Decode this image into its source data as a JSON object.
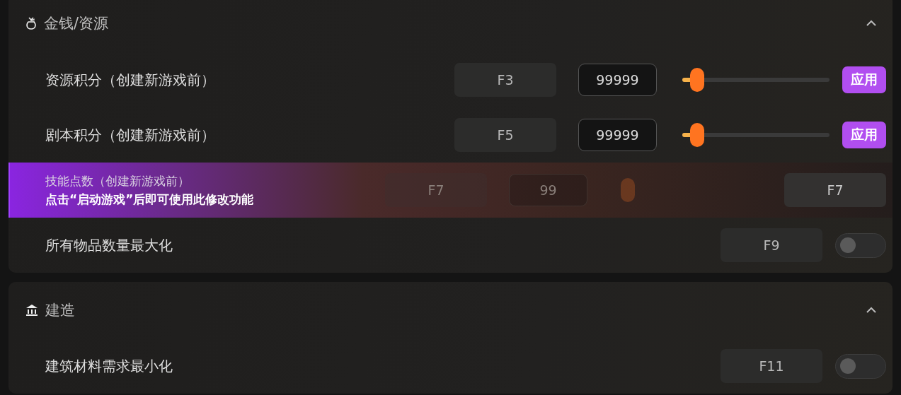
{
  "sections": [
    {
      "title": "金钱/资源",
      "kind": "bag",
      "expanded": true,
      "rows": [
        {
          "kind": "slider",
          "label": "资源积分（创建新游戏前）",
          "hotkey": "F3",
          "value": "99999",
          "level": 0.1,
          "button": "应用"
        },
        {
          "kind": "slider",
          "label": "剧本积分（创建新游戏前）",
          "hotkey": "F5",
          "value": "99999",
          "level": 0.1,
          "button": "应用"
        },
        {
          "kind": "locked",
          "label": "技能点数（创建新游戏前）",
          "message": "点击“启动游戏”后即可使用此修改功能",
          "hotkey": "F7",
          "value": "99",
          "button": "F7"
        },
        {
          "kind": "toggle",
          "label": "所有物品数量最大化",
          "hotkey": "F9",
          "on": false
        }
      ]
    },
    {
      "title": "建造",
      "kind": "building",
      "expanded": true,
      "rows": [
        {
          "kind": "toggle",
          "label": "建筑材料需求最小化",
          "hotkey": "F11",
          "on": false
        }
      ]
    }
  ]
}
